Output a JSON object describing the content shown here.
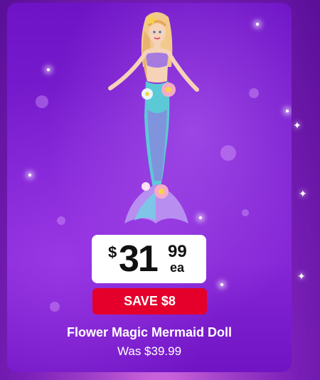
{
  "product": {
    "name": "Flower Magic Mermaid Doll",
    "was_price": "Was $39.99"
  },
  "price": {
    "currency_symbol": "$",
    "dollars": "31",
    "cents": "99",
    "unit": "ea"
  },
  "badge": {
    "label": "SAVE $8",
    "color": "#e4002b"
  },
  "colors": {
    "card_background": "#7a1ed0",
    "page_background": "#a040c8"
  },
  "icons": [
    "sparkle-icon"
  ]
}
